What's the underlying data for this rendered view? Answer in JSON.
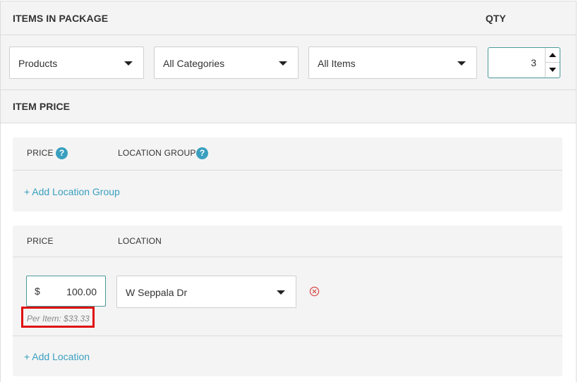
{
  "package": {
    "title": "ITEMS IN PACKAGE",
    "qty_label": "QTY",
    "filters": {
      "product_type": "Products",
      "category": "All Categories",
      "items": "All Items"
    },
    "qty_value": "3"
  },
  "item_price": {
    "title": "ITEM PRICE",
    "location_group_card": {
      "price_label": "PRICE",
      "location_group_label": "LOCATION GROUP",
      "help_glyph": "?",
      "add_link": "+ Add Location Group"
    },
    "location_card": {
      "price_label": "PRICE",
      "location_label": "LOCATION",
      "currency_symbol": "$",
      "price_value": "100.00",
      "per_item_text": "Per Item: $33.33",
      "location_value": "W Seppala Dr",
      "add_link": "+ Add Location"
    }
  },
  "icons": {
    "dropdown": "caret-down-icon",
    "help": "help-circle-icon",
    "remove": "remove-circle-icon",
    "spin_up": "spin-up-icon",
    "spin_down": "spin-down-icon"
  },
  "colors": {
    "accent": "#3a9fbf",
    "focus_border": "#4a9a98",
    "highlight": "#e01010",
    "remove": "#d9534f",
    "panel_bg": "#f4f4f4"
  }
}
